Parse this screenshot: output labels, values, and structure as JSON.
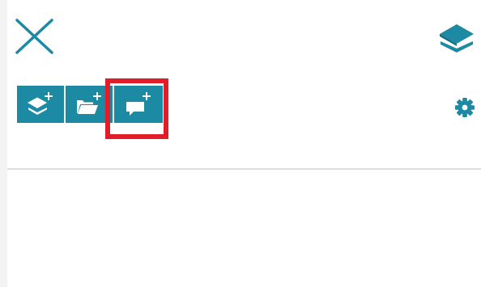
{
  "colors": {
    "accent": "#1b8aa2",
    "highlight": "#e11d2a",
    "icon": "#1b8aa2"
  },
  "header": {
    "close_icon": "close-icon",
    "layers_icon": "layers-icon"
  },
  "toolbar": {
    "buttons": [
      {
        "icon": "add-layer-icon"
      },
      {
        "icon": "add-folder-icon"
      },
      {
        "icon": "add-comment-icon",
        "highlighted": true
      }
    ],
    "settings_icon": "gear-icon"
  }
}
